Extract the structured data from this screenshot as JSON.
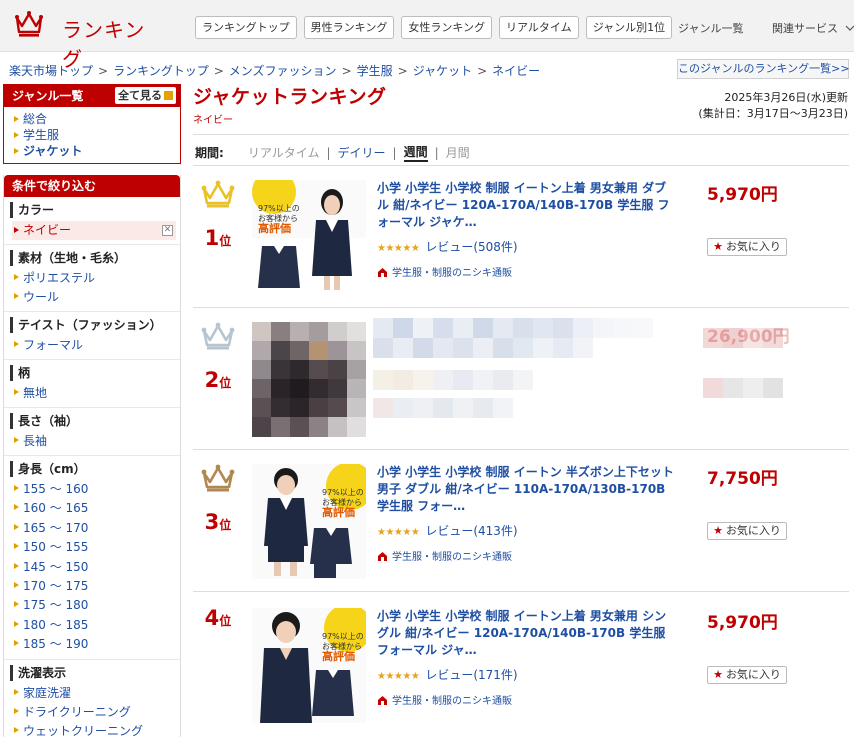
{
  "header": {
    "logo_text": "ランキング",
    "nav": [
      "ランキングトップ",
      "男性ランキング",
      "女性ランキング",
      "リアルタイム",
      "ジャンル別1位"
    ],
    "genre_list_link": "ジャンル一覧",
    "related_services": "関連サービス"
  },
  "breadcrumb": [
    "楽天市場トップ",
    "ランキングトップ",
    "メンズファッション",
    "学生服",
    "ジャケット",
    "ネイビー"
  ],
  "genre_ranking_link": "このジャンルのランキング一覧>>",
  "sidebar": {
    "genre_title": "ジャンル一覧",
    "show_all": "全て見る",
    "genres": [
      "総合",
      "学生服",
      "ジャケット"
    ],
    "filter_title": "条件で絞り込む",
    "sections": [
      {
        "title": "カラー",
        "items": [
          "ネイビー"
        ],
        "selected": 0
      },
      {
        "title": "素材（生地・毛糸）",
        "items": [
          "ポリエステル",
          "ウール"
        ]
      },
      {
        "title": "テイスト（ファッション）",
        "items": [
          "フォーマル"
        ]
      },
      {
        "title": "柄",
        "items": [
          "無地"
        ]
      },
      {
        "title": "長さ（袖）",
        "items": [
          "長袖"
        ]
      },
      {
        "title": "身長（cm）",
        "items": [
          "155 〜 160",
          "160 〜 165",
          "165 〜 170",
          "150 〜 155",
          "145 〜 150",
          "170 〜 175",
          "175 〜 180",
          "180 〜 185",
          "185 〜 190"
        ]
      },
      {
        "title": "洗濯表示",
        "items": [
          "家庭洗濯",
          "ドライクリーニング",
          "ウェットクリーニング"
        ]
      }
    ]
  },
  "main": {
    "title": "ジャケットランキング",
    "subgenre": "ネイビー",
    "updated": "2025年3月26日(水)更新",
    "period_range": "(集計日：3月17日〜3月23日)",
    "period_label": "期間:",
    "period_tabs": [
      "リアルタイム",
      "デイリー",
      "週間",
      "月間"
    ],
    "active_period": "週間"
  },
  "items": [
    {
      "rank": "1",
      "rank_suffix": "位",
      "crown_color": "#e8c227",
      "name": "小学 小学生 小学校 制服 イートン上着 男女兼用 ダブル 紺/ネイビー 120A-170A/140B-170B 学生服 フォーマル ジャケ…",
      "price": "5,970円",
      "review": "レビュー(508件)",
      "shop": "学生服・制服のニシキ通販",
      "fav": "お気に入り",
      "badge_line1": "97%以上の",
      "badge_line2": "お客様から",
      "badge_line3": "高評価"
    },
    {
      "rank": "2",
      "rank_suffix": "位",
      "crown_color": "#b8c4d0",
      "name": "",
      "price": "26,900円",
      "review": "",
      "shop": "",
      "fav": ""
    },
    {
      "rank": "3",
      "rank_suffix": "位",
      "crown_color": "#b08850",
      "name": "小学 小学生 小学校 制服 イートン 半ズボン上下セット 男子 ダブル 紺/ネイビー 110A-170A/130B-170B 学生服 フォー…",
      "price": "7,750円",
      "review": "レビュー(413件)",
      "shop": "学生服・制服のニシキ通販",
      "fav": "お気に入り",
      "badge_line1": "97%以上の",
      "badge_line2": "お客様から",
      "badge_line3": "高評価"
    },
    {
      "rank": "4",
      "rank_suffix": "位",
      "name": "小学 小学生 小学校 制服 イートン上着 男女兼用 シングル 紺/ネイビー 120A-170A/140B-170B 学生服 フォーマル ジャ…",
      "price": "5,970円",
      "review": "レビュー(171件)",
      "shop": "学生服・制服のニシキ通販",
      "fav": "お気に入り",
      "badge_line1": "97%以上の",
      "badge_line2": "お客様から",
      "badge_line3": "高評価"
    }
  ]
}
